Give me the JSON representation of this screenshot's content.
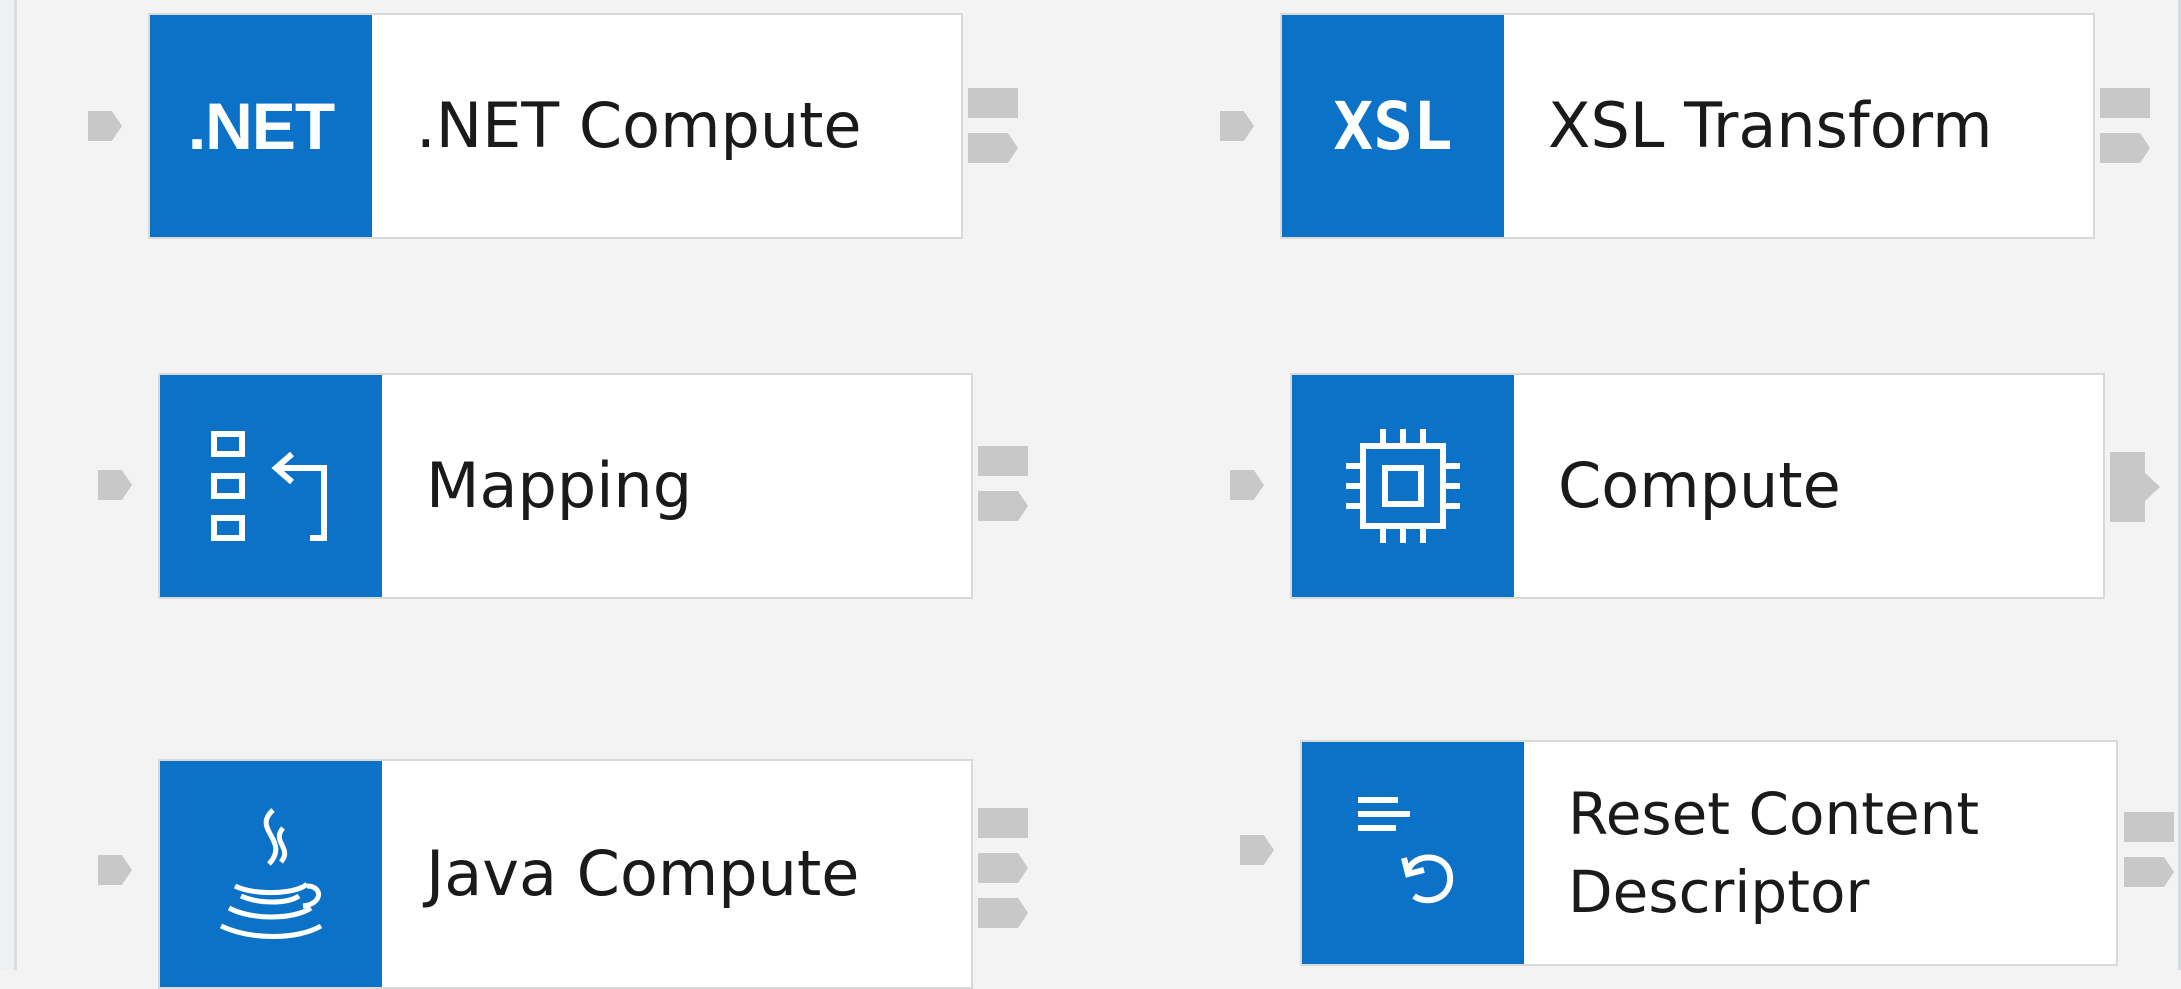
{
  "nodes": [
    {
      "id": "dotnet",
      "label": ".NET Compute",
      "icon": "dotnet-text-icon",
      "icon_text": ".NET"
    },
    {
      "id": "xsl",
      "label": "XSL Transform",
      "icon": "xsl-text-icon",
      "icon_text": "XSL"
    },
    {
      "id": "mapping",
      "label": "Mapping",
      "icon": "mapping-icon"
    },
    {
      "id": "compute",
      "label": "Compute",
      "icon": "chip-icon"
    },
    {
      "id": "java",
      "label": "Java Compute",
      "icon": "java-coffee-icon"
    },
    {
      "id": "reset",
      "label_line1": "Reset Content",
      "label_line2": "Descriptor",
      "icon": "reset-content-icon"
    }
  ],
  "colors": {
    "icon_background": "#0c72c7",
    "canvas": "#f3f3f3",
    "terminal": "#c8c8c8"
  }
}
